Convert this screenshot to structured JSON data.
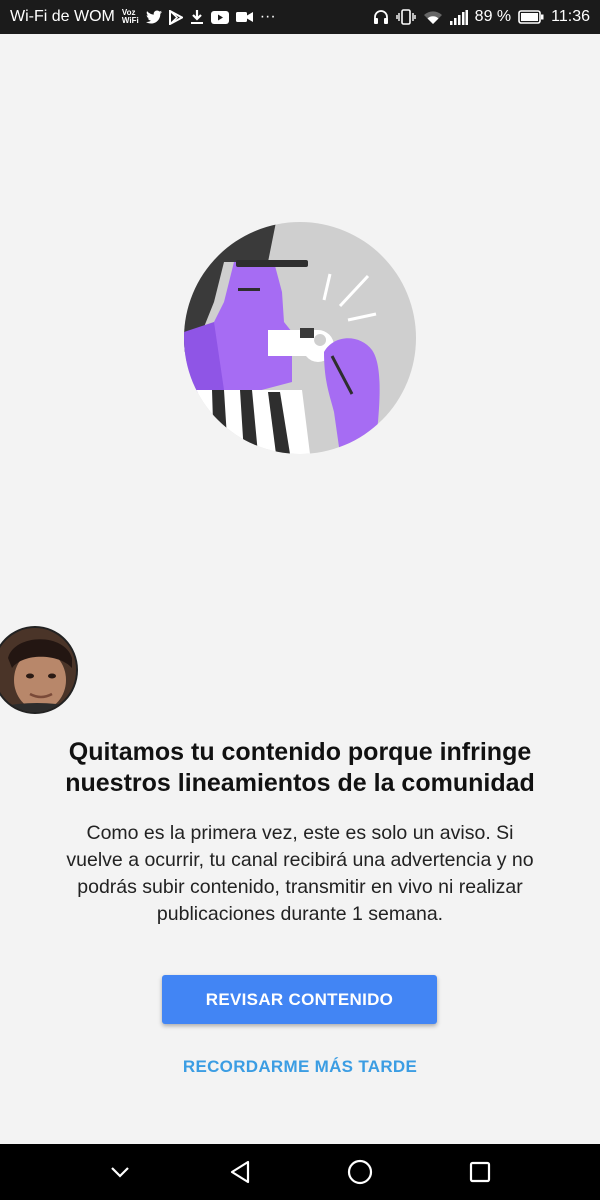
{
  "status_bar": {
    "carrier": "Wi-Fi de WOM",
    "voz_top": "Voz",
    "voz_bottom": "WiFi",
    "overflow": "···",
    "battery_percent": "89 %",
    "time": "11:36",
    "left_icons": [
      "twitter-icon",
      "play-store-icon",
      "download-icon",
      "youtube-icon",
      "video-camera-icon"
    ],
    "right_icons": [
      "headset-icon",
      "vibrate-icon",
      "wifi-icon",
      "signal-icon",
      "battery-icon"
    ]
  },
  "notice": {
    "title_line1": "Quitamos tu contenido porque infringe",
    "title_line2": "nuestros lineamientos de la comunidad",
    "body_line1": "Como es la primera vez, este es solo un aviso. Si",
    "body_line2": "vuelve a ocurrir, tu canal recibirá una advertencia y no",
    "body_line3": "podrás subir contenido, transmitir en vivo ni realizar",
    "body_line4": "publicaciones durante 1 semana."
  },
  "actions": {
    "primary": "REVISAR CONTENIDO",
    "secondary": "RECORDARME MÁS TARDE"
  },
  "colors": {
    "primary_button": "#4285f4",
    "link": "#3b9de3",
    "illustration_purple": "#a66cf3",
    "illustration_gray": "#cfcfcf"
  },
  "nav": [
    "chevron-down-icon",
    "back-icon",
    "home-icon",
    "recents-icon"
  ]
}
